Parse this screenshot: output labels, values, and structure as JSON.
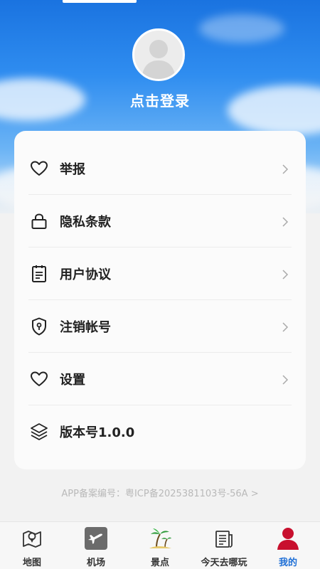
{
  "profile": {
    "login_text": "点击登录"
  },
  "menu": {
    "items": [
      {
        "label": "举报",
        "icon": "heart-icon"
      },
      {
        "label": "隐私条款",
        "icon": "lock-icon"
      },
      {
        "label": "用户协议",
        "icon": "document-icon"
      },
      {
        "label": "注销帐号",
        "icon": "shield-icon"
      },
      {
        "label": "设置",
        "icon": "heart-icon"
      },
      {
        "label": "版本号1.0.0",
        "icon": "layers-icon"
      }
    ]
  },
  "footer": {
    "icp": "APP备案编号：粤ICP备2025381103号-56A >"
  },
  "tabs": [
    {
      "label": "地图",
      "icon": "map-pin-icon"
    },
    {
      "label": "机场",
      "icon": "airplane-icon"
    },
    {
      "label": "景点",
      "icon": "palm-tree-icon"
    },
    {
      "label": "今天去哪玩",
      "icon": "newspaper-icon"
    },
    {
      "label": "我的",
      "icon": "user-icon",
      "active": true
    }
  ],
  "colors": {
    "accent": "#1e6fd6",
    "avatar_active": "#c8102e"
  }
}
